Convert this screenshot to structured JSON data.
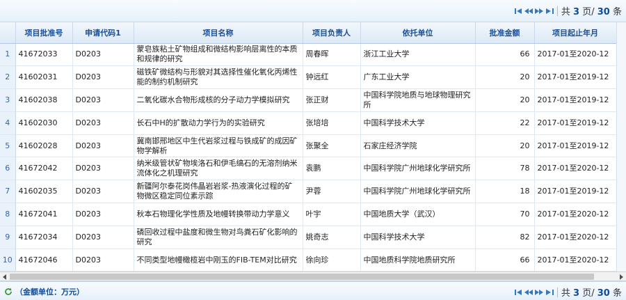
{
  "pager": {
    "info_prefix": "共",
    "total_pages": "3",
    "info_middle": "页/",
    "total_records": "30",
    "info_suffix": "条"
  },
  "table": {
    "columns": [
      "项目批准号",
      "申请代码1",
      "项目名称",
      "项目负责人",
      "依托单位",
      "批准金额",
      "项目起止年月"
    ],
    "rows": [
      {
        "num": "1",
        "id": "41672033",
        "code": "D0203",
        "name": "蒙皂族粘土矿物组成和微结构影响层离性的本质和规律的研究",
        "leader": "周春晖",
        "org": "浙江工业大学",
        "amount": "66",
        "period": "2017-01至2020-12"
      },
      {
        "num": "2",
        "id": "41602031",
        "code": "D0203",
        "name": "磁铁矿微结构与形貌对其选择性催化氧化丙烯性能的制约机制研究",
        "leader": "钟远红",
        "org": "广东工业大学",
        "amount": "20",
        "period": "2017-01至2019-12"
      },
      {
        "num": "3",
        "id": "41602038",
        "code": "D0203",
        "name": "二氧化碳水合物形成核的分子动力学模拟研究",
        "leader": "张正财",
        "org": "中国科学院地质与地球物理研究所",
        "amount": "20",
        "period": "2017-01至2019-12"
      },
      {
        "num": "4",
        "id": "41602030",
        "code": "D0203",
        "name": "长石中H的扩散动力学行为的实验研究",
        "leader": "张培培",
        "org": "中国科学技术大学",
        "amount": "22",
        "period": "2017-01至2019-12"
      },
      {
        "num": "5",
        "id": "41602028",
        "code": "D0203",
        "name": "冀南邯邢地区中生代岩浆过程与铁成矿的成因矿物学解析",
        "leader": "张聚全",
        "org": "石家庄经济学院",
        "amount": "20",
        "period": "2017-01至2019-12"
      },
      {
        "num": "6",
        "id": "41672042",
        "code": "D0203",
        "name": "纳米级管状矿物埃洛石和伊毛缟石的无溶剂纳米流体化之机理研究",
        "leader": "袁鹏",
        "org": "中国科学院广州地球化学研究所",
        "amount": "78",
        "period": "2017-01至2020-12"
      },
      {
        "num": "7",
        "id": "41602035",
        "code": "D0203",
        "name": "新疆阿尔泰花岗伟晶岩岩浆-热液演化过程的矿物微区稳定同位素示踪",
        "leader": "尹蓉",
        "org": "中国科学院广州地球化学研究所",
        "amount": "18",
        "period": "2017-01至2019-12"
      },
      {
        "num": "8",
        "id": "41672041",
        "code": "D0203",
        "name": "秋本石物理化学性质及地幔转换带动力学意义",
        "leader": "叶宇",
        "org": "中国地质大学（武汉）",
        "amount": "70",
        "period": "2017-01至2020-12"
      },
      {
        "num": "9",
        "id": "41672034",
        "code": "D0203",
        "name": "磷回收过程中盐度和微生物对鸟粪石矿化影响的研究",
        "leader": "姚奇志",
        "org": "中国科学技术大学",
        "amount": "82",
        "period": "2017-01至2020-12"
      },
      {
        "num": "10",
        "id": "41672046",
        "code": "D0203",
        "name": "不同类型地幔橄榄岩中刚玉的FIB-TEM对比研究",
        "leader": "徐向珍",
        "org": "中国地质科学院地质研究所",
        "amount": "66",
        "period": "2017-01至2020-12"
      }
    ]
  },
  "footer": {
    "note": "（金额单位：万元）"
  },
  "icons": {
    "first": "first-page-icon",
    "prev": "prev-page-icon",
    "next": "next-page-icon",
    "last": "last-page-icon",
    "refresh": "refresh-icon"
  },
  "colors": {
    "header_text": "#1a4f97",
    "pager_icon": "#2f78c8"
  }
}
